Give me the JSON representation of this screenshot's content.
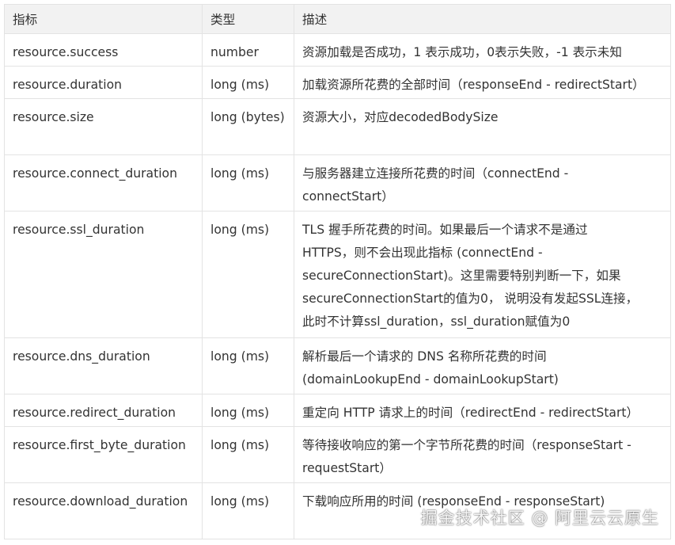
{
  "header": {
    "metric": "指标",
    "type": "类型",
    "description": "描述"
  },
  "rows": [
    {
      "metric": "resource.success",
      "type": "number",
      "description": [
        "资源加载是否成功，1 表示成功，0表示失败，-1 表示未知"
      ]
    },
    {
      "metric": "resource.duration",
      "type": "long (ms)",
      "description": [
        "加载资源所花费的全部时间（responseEnd - redirectStart）"
      ]
    },
    {
      "metric": "resource.size",
      "type": "long (bytes)",
      "description": [
        "资源大小，对应decodedBodySize"
      ]
    },
    {
      "metric": "resource.connect_duration",
      "type": "long (ms)",
      "description": [
        "与服务器建立连接所花费的时间（connectEnd -",
        "connectStart）"
      ]
    },
    {
      "metric": "resource.ssl_duration",
      "type": "long (ms)",
      "description": [
        "TLS 握手所花费的时间。如果最后一个请求不是通过",
        "HTTPS，则不会出现此指标 (connectEnd -",
        "secureConnectionStart)。这里需要特别判断一下，如果",
        "secureConnectionStart的值为0， 说明没有发起SSL连接，",
        "此时不计算ssl_duration，ssl_duration赋值为0"
      ]
    },
    {
      "metric": "resource.dns_duration",
      "type": "long (ms)",
      "description": [
        "解析最后一个请求的 DNS 名称所花费的时间",
        "(domainLookupEnd - domainLookupStart)"
      ]
    },
    {
      "metric": "resource.redirect_duration",
      "type": "long (ms)",
      "description": [
        "重定向 HTTP 请求上的时间（redirectEnd - redirectStart）"
      ]
    },
    {
      "metric": "resource.first_byte_duration",
      "type": "long (ms)",
      "description": [
        "等待接收响应的第一个字节所花费的时间（responseStart -",
        "requestStart）"
      ]
    },
    {
      "metric": "resource.download_duration",
      "type": "long (ms)",
      "description": [
        "下载响应所用的时间 (responseEnd - responseStart)"
      ]
    }
  ],
  "watermark": "掘金技术社区 @ 阿里云云原生"
}
